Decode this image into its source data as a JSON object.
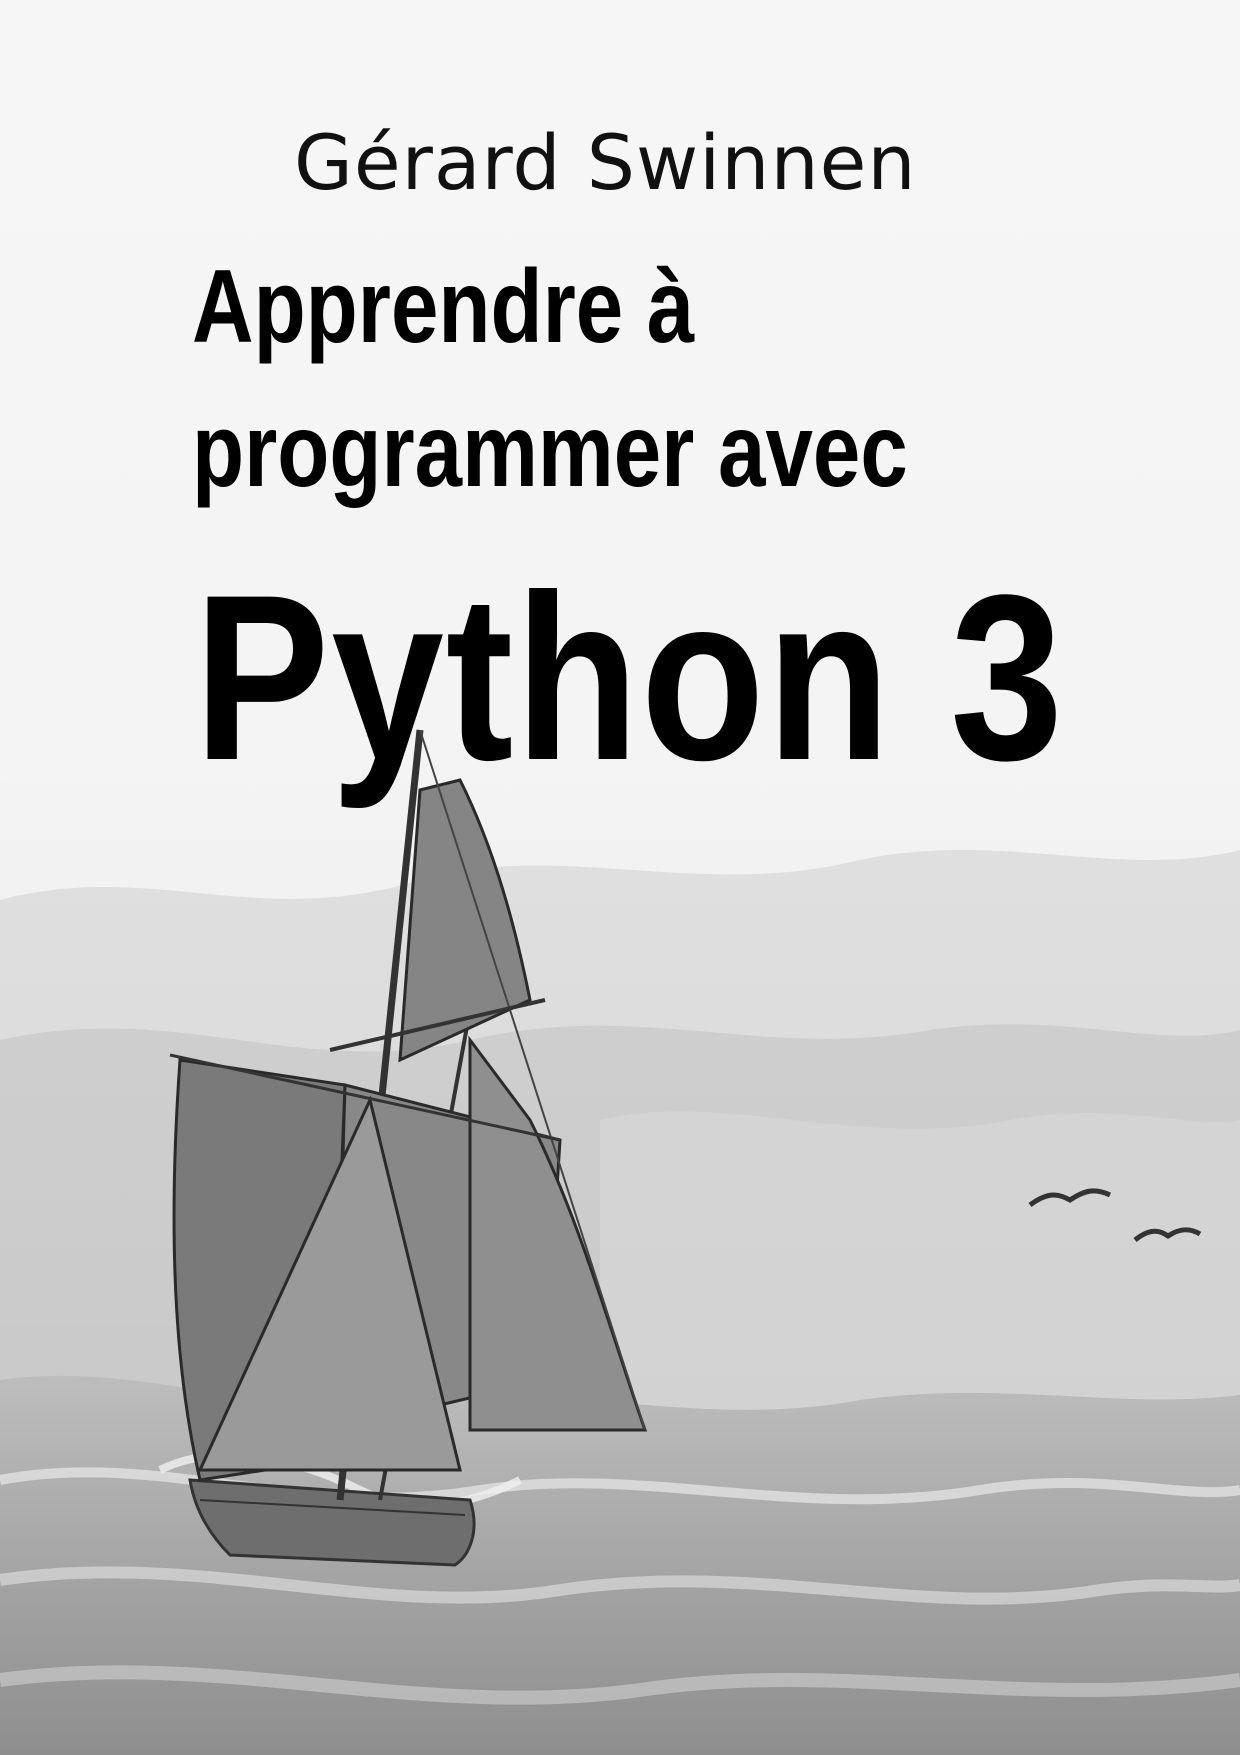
{
  "cover": {
    "author": "Gérard Swinnen",
    "title_line1": "Apprendre à",
    "title_line2": "programmer avec",
    "title_main": "Python 3"
  },
  "illustration": {
    "subject": "sailing-ship-icon",
    "tone": "#8a8a8a"
  }
}
